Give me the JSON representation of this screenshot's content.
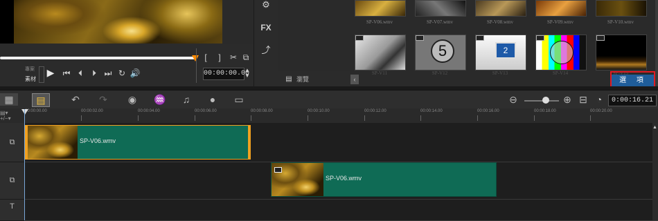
{
  "player": {
    "mode_project_label": "專案",
    "mode_clip_label": "素材",
    "mark_in": "[",
    "mark_out": "]",
    "timecode": "00:00:00.00"
  },
  "tools": {
    "fx_label": "FX"
  },
  "library": {
    "row1_labels": [
      "SP-V06.wmv",
      "SP-V07.wmv",
      "SP-V08.wmv",
      "SP-V09.wmv",
      "SP-V10.wmv"
    ],
    "row2_labels": [
      "SP-V11",
      "SP-V12",
      "SP-V13",
      "SP-V14",
      "SP-V15"
    ],
    "countdown_number": "5",
    "screen_number": "2",
    "browse_label": "瀏覽",
    "options_label": "選 項"
  },
  "timeline": {
    "duration": "0:00:16.21",
    "ruler": [
      "00:00:00.00",
      "00:00:02.00",
      "00:00:04.00",
      "00:00:06.00",
      "00:00:08.00",
      "00:00:10.00",
      "00:00:12.00",
      "00:00:14.00",
      "00:00:16.00",
      "00:00:18.00",
      "00:00:20.00"
    ],
    "clip1_name": "SP-V06.wmv",
    "clip2_name": "SP-V06.wmv",
    "title_track_label": "T"
  },
  "colors": {
    "clip": "#0f6b55",
    "selection": "#f0a020",
    "highlight": "#e31b23",
    "options_button": "#1f5d9a"
  }
}
